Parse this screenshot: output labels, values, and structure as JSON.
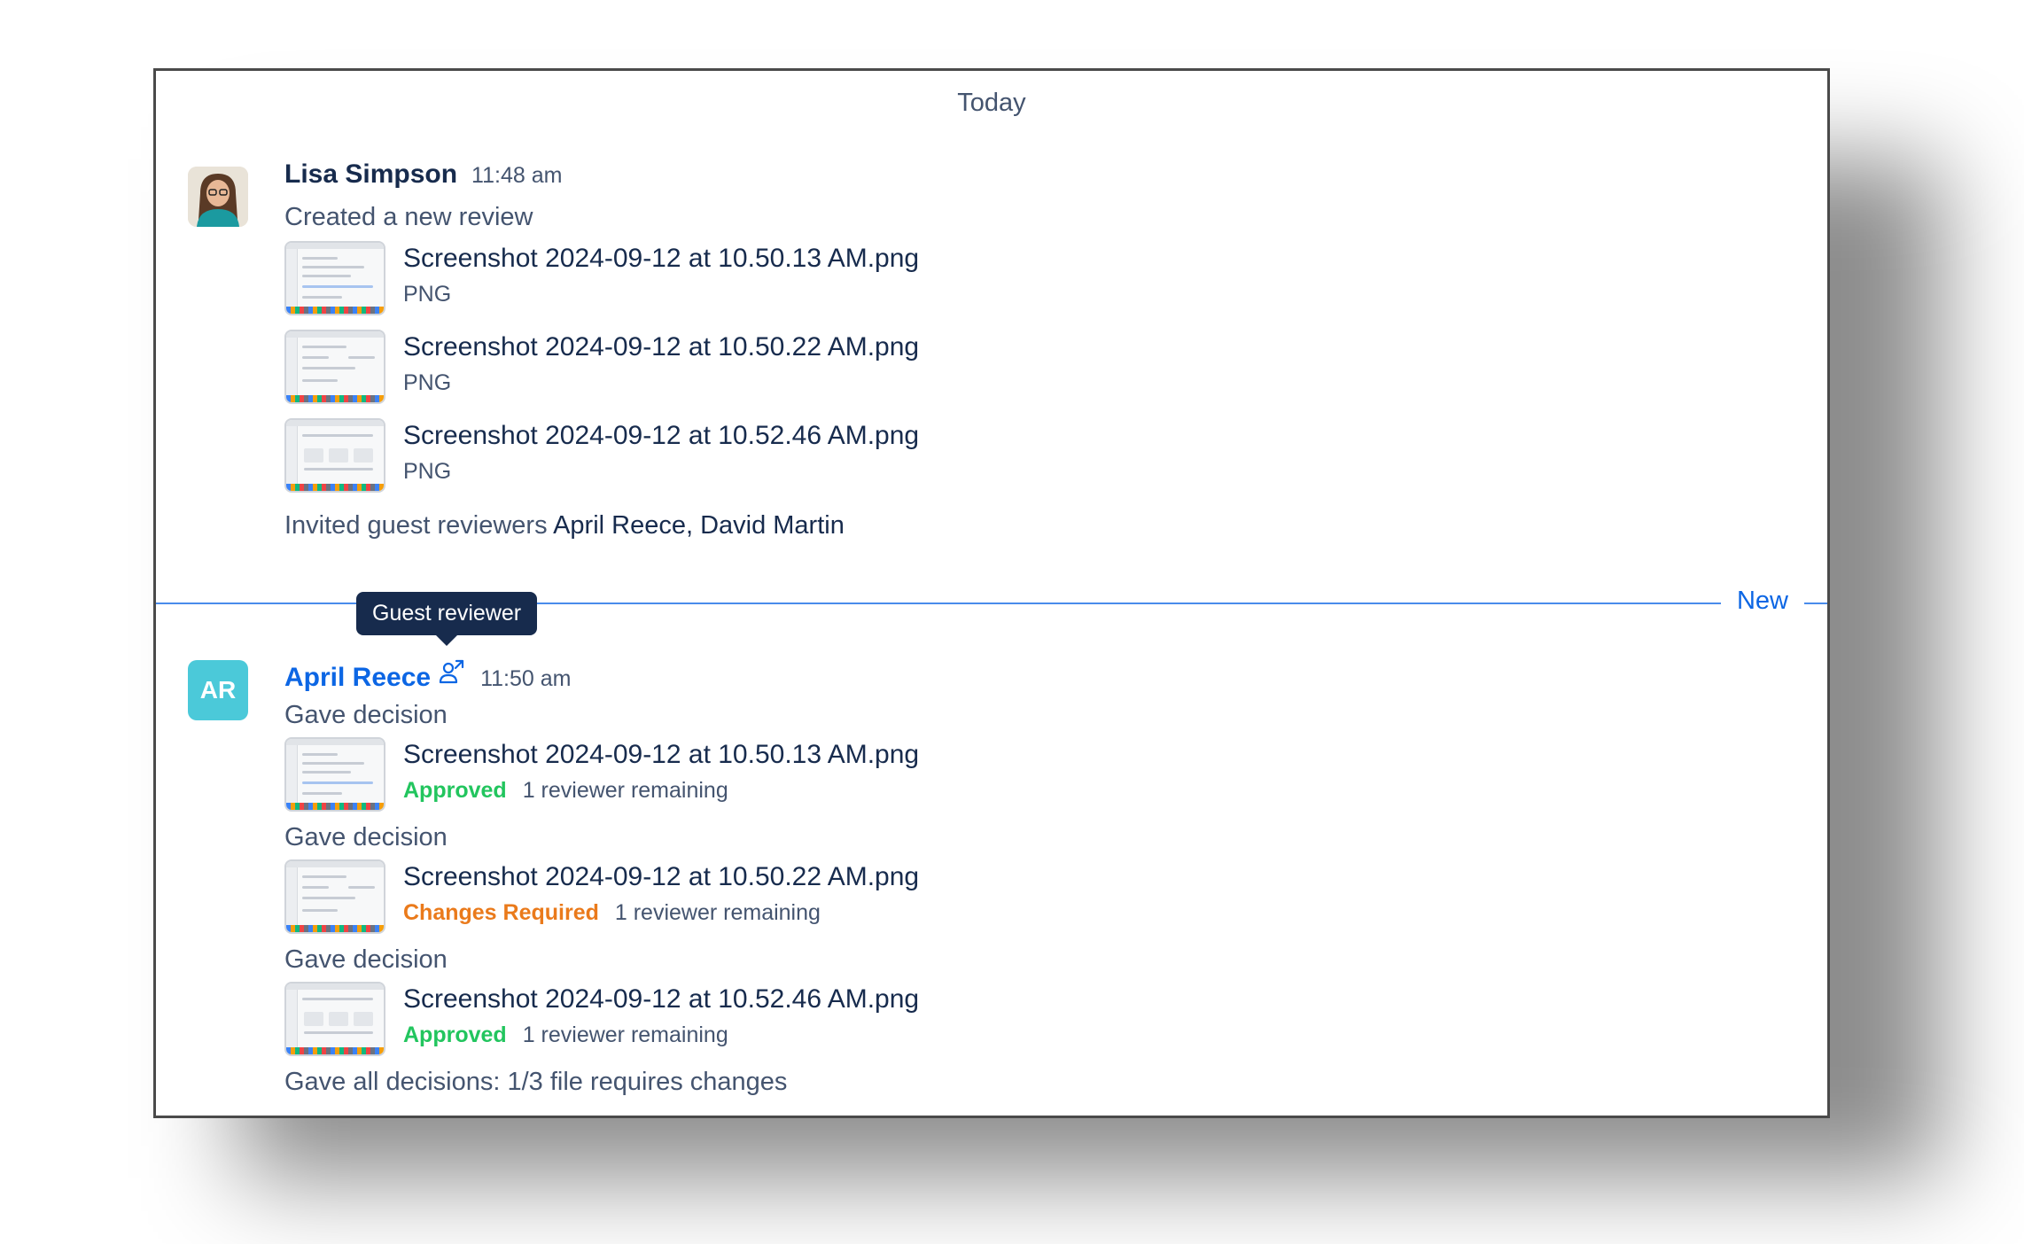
{
  "day_label": "Today",
  "new_label": "New",
  "tooltip": "Guest reviewer",
  "entries": [
    {
      "author": "Lisa Simpson",
      "time": "11:48 am",
      "action": "Created a new review",
      "files": [
        {
          "name": "Screenshot 2024-09-12 at 10.50.13 AM.png",
          "type": "PNG"
        },
        {
          "name": "Screenshot 2024-09-12 at 10.50.22 AM.png",
          "type": "PNG"
        },
        {
          "name": "Screenshot 2024-09-12 at 10.52.46 AM.png",
          "type": "PNG"
        }
      ],
      "invited_prefix": "Invited guest reviewers",
      "invited_names": "April Reece, David Martin"
    },
    {
      "author": "April Reece",
      "initials": "AR",
      "avatar_color": "#4bc9d9",
      "time": "11:50 am",
      "decisions": [
        {
          "action": "Gave decision",
          "file": "Screenshot 2024-09-12 at 10.50.13 AM.png",
          "status": "Approved",
          "remaining": "1 reviewer remaining"
        },
        {
          "action": "Gave decision",
          "file": "Screenshot 2024-09-12 at 10.50.22 AM.png",
          "status": "Changes Required",
          "remaining": "1 reviewer remaining"
        },
        {
          "action": "Gave decision",
          "file": "Screenshot 2024-09-12 at 10.52.46 AM.png",
          "status": "Approved",
          "remaining": "1 reviewer remaining"
        }
      ],
      "summary": "Gave all decisions: 1/3 file requires changes"
    }
  ],
  "colors": {
    "link": "#0c66e4",
    "approved": "#22c55e",
    "changes_required": "#ea7a1b",
    "tooltip_bg": "#172b4d"
  },
  "icons": {
    "guest_reviewer": "guest-reviewer-icon"
  }
}
